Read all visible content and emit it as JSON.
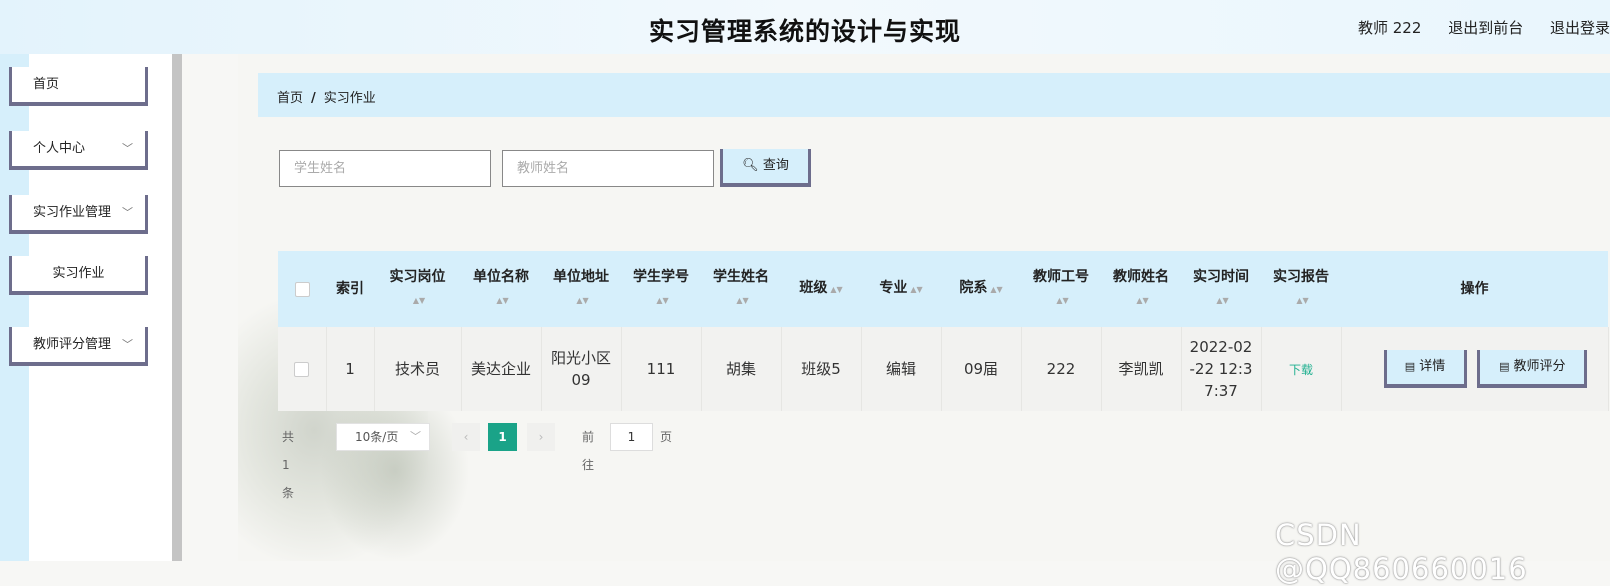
{
  "header": {
    "title": "实习管理系统的设计与实现",
    "user_label": "教师 222",
    "back_to_front": "退出到前台",
    "logout": "退出登录"
  },
  "sidebar": {
    "items": [
      {
        "label": "首页"
      },
      {
        "label": "个人中心"
      },
      {
        "label": "实习作业管理"
      },
      {
        "label": "实习作业"
      },
      {
        "label": "教师评分管理"
      }
    ]
  },
  "breadcrumb": {
    "home": "首页",
    "separator": "/",
    "current": "实习作业"
  },
  "search": {
    "student_name_placeholder": "学生姓名",
    "teacher_name_placeholder": "教师姓名",
    "button_label": "查询"
  },
  "table": {
    "headers": [
      "索引",
      "实习岗位",
      "单位名称",
      "单位地址",
      "学生学号",
      "学生姓名",
      "班级",
      "专业",
      "院系",
      "教师工号",
      "教师姓名",
      "实习时间",
      "实习报告",
      "操作"
    ],
    "rows": [
      {
        "index": "1",
        "position": "技术员",
        "company": "美达企业",
        "address": "阳光小区09",
        "student_no": "111",
        "student_name": "胡集",
        "class": "班级5",
        "major": "编辑",
        "department": "09届",
        "teacher_no": "222",
        "teacher_name": "李凯凯",
        "time": "2022-02-22 12:37:37",
        "report_link": "下载",
        "actions": {
          "detail": "详情",
          "rating": "教师评分"
        }
      }
    ]
  },
  "pagination": {
    "total": "共 1 条",
    "page_size": "10条/页",
    "current_page": "1",
    "goto_prefix": "前往",
    "goto_value": "1",
    "goto_suffix": "页"
  },
  "watermark": "CSDN @QQ860660016",
  "colors": {
    "accent_blue": "#d6effb",
    "border_slate": "#6d6d8c",
    "page_active": "#1aa388",
    "download_link": "#20b090"
  }
}
